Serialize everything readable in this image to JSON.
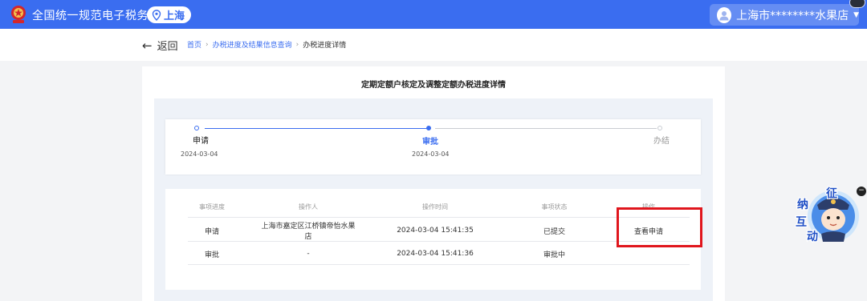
{
  "header": {
    "site_title": "全国统一规范电子税务局",
    "region": "上海",
    "user_name": "上海市********水果店",
    "colors": {
      "brand_blue": "#3a6df0"
    }
  },
  "breadcrumb": {
    "back_label": "返回",
    "items": [
      "首页",
      "办税进度及结果信息查询"
    ],
    "current": "办税进度详情"
  },
  "card": {
    "title": "定期定额户核定及调整定额办税进度详情"
  },
  "progress": {
    "steps": [
      {
        "label": "申请",
        "date": "2024-03-04",
        "state": "done"
      },
      {
        "label": "审批",
        "date": "2024-03-04",
        "state": "current"
      },
      {
        "label": "办结",
        "date": "",
        "state": "pending"
      }
    ]
  },
  "table": {
    "headers": [
      "事项进度",
      "操作人",
      "操作时间",
      "事项状态",
      "操作"
    ],
    "rows": [
      {
        "stage": "申请",
        "operator": "上海市嘉定区江桥镇帝怡水果店",
        "time": "2024-03-04 15:41:35",
        "status": "已提交",
        "action": "查看申请"
      },
      {
        "stage": "审批",
        "operator": "-",
        "time": "2024-03-04 15:41:36",
        "status": "审批中",
        "action": ""
      }
    ]
  },
  "mascot": {
    "chars": [
      "征",
      "纳",
      "互",
      "动"
    ],
    "close_label": "−"
  }
}
